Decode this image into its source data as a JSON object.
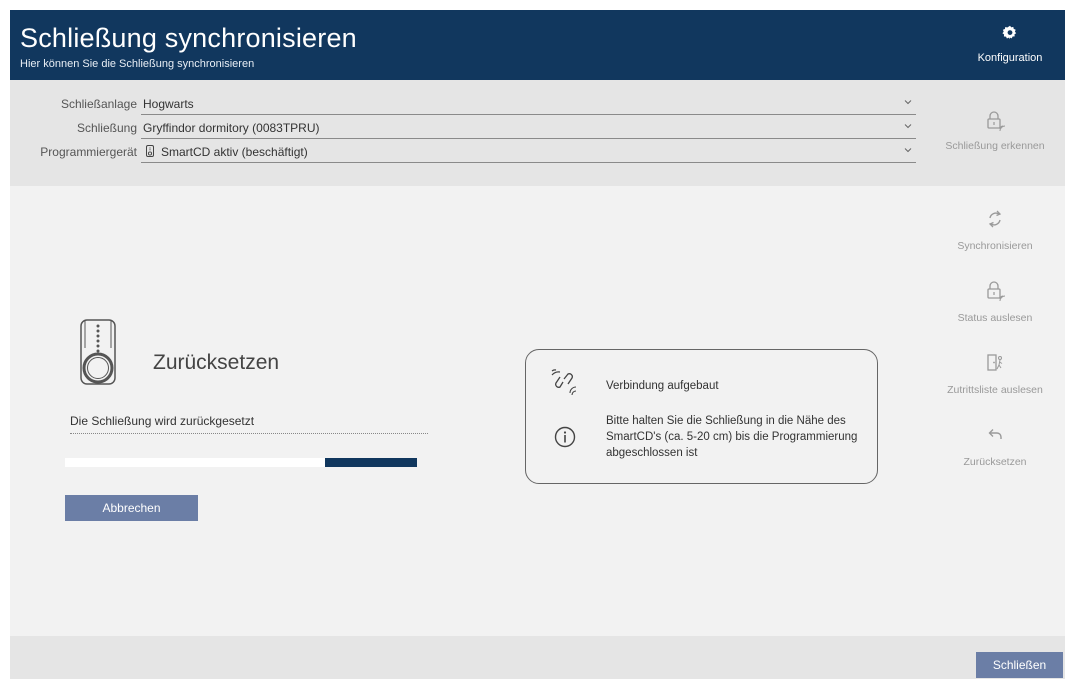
{
  "header": {
    "title": "Schließung synchronisieren",
    "subtitle": "Hier können Sie die Schließung synchronisieren",
    "config_label": "Konfiguration"
  },
  "form": {
    "rows": [
      {
        "label": "Schließanlage",
        "value": "Hogwarts"
      },
      {
        "label": "Schließung",
        "value": "Gryffindor dormitory (0083TPRU)"
      },
      {
        "label": "Programmiergerät",
        "value": "SmartCD aktiv (beschäftigt)"
      }
    ]
  },
  "side_actions": {
    "detect": "Schließung erkennen",
    "sync": "Synchronisieren",
    "status": "Status auslesen",
    "access_list": "Zutrittsliste auslesen",
    "reset": "Zurücksetzen"
  },
  "main": {
    "title": "Zurücksetzen",
    "status_text": "Die Schließung wird zurückgesetzt",
    "progress": {
      "segment_start": 0.74,
      "segment_end": 1.0
    },
    "abort_label": "Abbrechen"
  },
  "info": {
    "connection": "Verbindung aufgebaut",
    "hint": "Bitte halten Sie die Schließung in die Nähe des SmartCD's (ca. 5-20 cm) bis die Programmierung abgeschlossen ist"
  },
  "footer": {
    "close_label": "Schließen"
  },
  "colors": {
    "header_bg": "#11375e",
    "button_bg": "#6b7ea6",
    "progress_fill": "#11375e"
  }
}
